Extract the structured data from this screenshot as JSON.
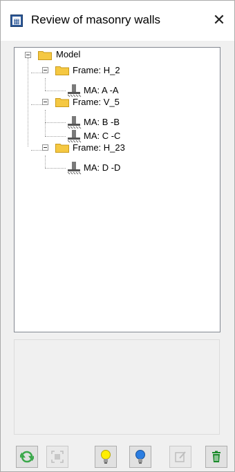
{
  "window": {
    "title": "Review of masonry walls",
    "close_label": "✕"
  },
  "tree": {
    "root": {
      "label": "Model"
    },
    "frames": [
      {
        "label": "Frame: H_2",
        "walls": [
          {
            "label": "MA: A -A"
          }
        ]
      },
      {
        "label": "Frame: V_5",
        "walls": [
          {
            "label": "MA: B -B"
          },
          {
            "label": "MA: C -C"
          }
        ]
      },
      {
        "label": "Frame: H_23",
        "walls": [
          {
            "label": "MA: D -D"
          }
        ]
      }
    ]
  },
  "toolbar": {
    "buttons": [
      {
        "name": "refresh-button",
        "icon": "refresh-icon",
        "enabled": true
      },
      {
        "name": "zoom-to-button",
        "icon": "zoom-target-icon",
        "enabled": false
      },
      {
        "name": "highlight-yellow-button",
        "icon": "yellow-bulb-icon",
        "enabled": true
      },
      {
        "name": "highlight-blue-button",
        "icon": "blue-bulb-icon",
        "enabled": true
      },
      {
        "name": "edit-button",
        "icon": "edit-icon",
        "enabled": false
      },
      {
        "name": "delete-button",
        "icon": "trash-icon",
        "enabled": true
      }
    ]
  },
  "colors": {
    "folder": "#f5c842",
    "bulb_yellow": "#ffee00",
    "bulb_blue": "#2a7de1",
    "trash": "#1a8a2a",
    "refresh": "#3aa84a"
  }
}
